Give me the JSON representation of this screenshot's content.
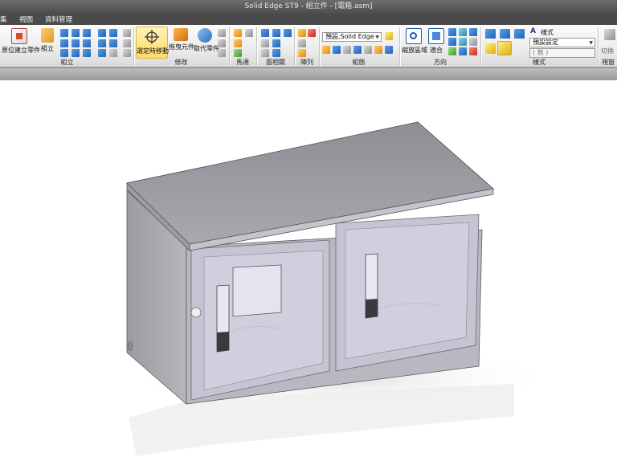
{
  "window": {
    "title": "Solid Edge ST9 - 組立件 - [電箱.asm]"
  },
  "menu": [
    "集",
    "視圖",
    "資料管理"
  ],
  "ribbon": {
    "groups": {
      "assemble": "組立",
      "modify": "修改",
      "motor": "馬達",
      "face_relate": "面相關",
      "pattern": "陣列",
      "configuration": "組態",
      "orient": "方向",
      "style": "樣式",
      "views": "視窗"
    },
    "buttons": {
      "create_in_place": "原位建立零件",
      "assemble": "組立",
      "select_move": "選定時移動",
      "drag_component": "拖曳元件",
      "replace_part": "取代零件",
      "zoom_area": "縮放區域",
      "fit": "適合",
      "style": "樣式"
    },
    "combos": {
      "configuration": "預設,Solid Edge",
      "style_preset": "預設設定",
      "style_none": "( 無 )"
    },
    "truncated_right": "切換"
  },
  "colors": {
    "titlebar": "#5a5a5a",
    "menubar": "#4a4a4a",
    "active_button": "#ffd96a",
    "model_gray": "#a7a7ad",
    "model_glass": "#c9c8d6"
  },
  "icons": [
    "create-part-icon",
    "assemble-icon",
    "relationship-icon",
    "select-move-icon",
    "drag-component-icon",
    "replace-part-icon",
    "motor-icon",
    "zoom-area-icon",
    "fit-icon",
    "cube-view-icon",
    "style-icon"
  ]
}
